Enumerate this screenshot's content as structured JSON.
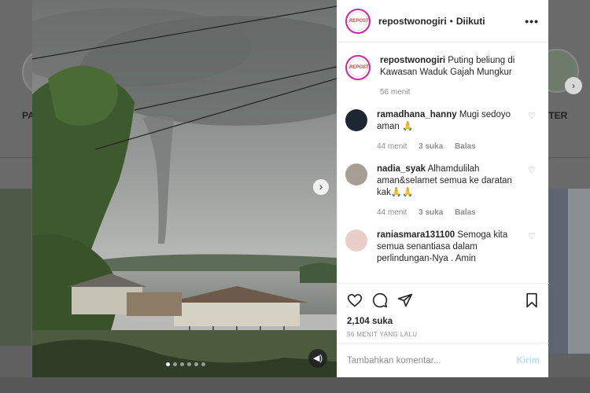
{
  "background": {
    "left_label": "PA",
    "right_label": "TTER"
  },
  "post": {
    "username": "repostwonogiri",
    "follow_status": "Diikuti",
    "avatar_text": "REPOST",
    "caption": {
      "user": "repostwonogiri",
      "text": "Puting beliung di Kawasan Waduk Gajah Mungkur",
      "time": "56 menit"
    },
    "carousel": {
      "slide_count": 6,
      "active_index": 0
    }
  },
  "comments": [
    {
      "user": "ramadhana_hanny",
      "text": "Mugi sedoyo aman 🙏",
      "time": "44 menit",
      "likes": "3 suka",
      "reply": "Balas",
      "avatar_color": "#1d2633"
    },
    {
      "user": "nadia_syak",
      "text": "Alhamdulilah aman&selamet semua ke daratan kak🙏🙏",
      "time": "44 menit",
      "likes": "3 suka",
      "reply": "Balas",
      "avatar_color": "#a89f94"
    },
    {
      "user": "raniasmara131100",
      "text": "Semoga kita semua senantiasa dalam perlindungan-Nya . Amin",
      "time": "",
      "likes": "",
      "reply": "",
      "avatar_color": "#e9cfc7"
    }
  ],
  "footer": {
    "likes_count": "2,104 suka",
    "posted": "56 MENIT YANG LALU",
    "comment_placeholder": "Tambahkan komentar...",
    "send_label": "Kirim"
  },
  "colors": {
    "accent_send": "#b2dffc",
    "text_primary": "#262626",
    "text_secondary": "#8e8e8e"
  }
}
